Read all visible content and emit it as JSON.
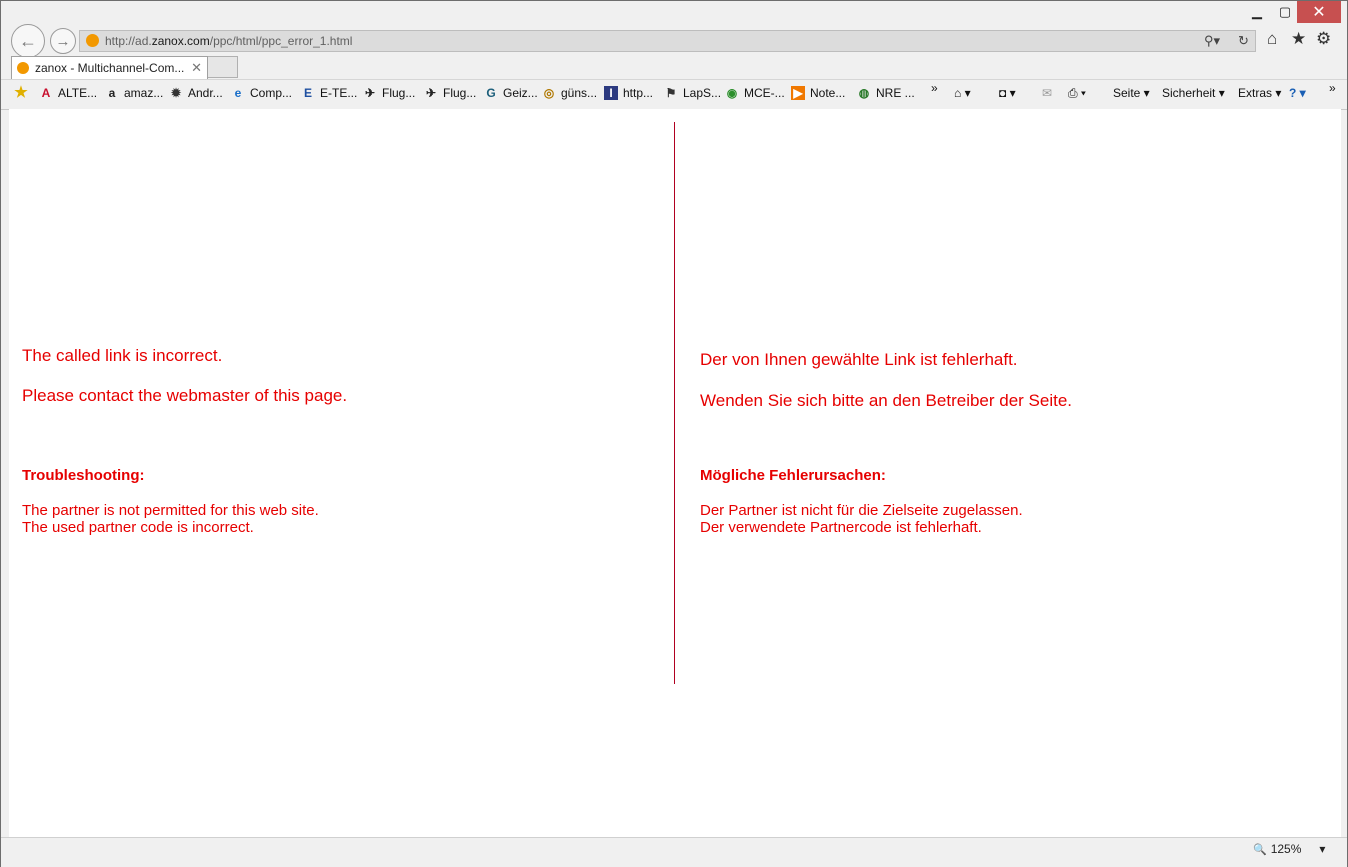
{
  "window": {
    "minimize": "▁",
    "maximize": "▢",
    "close": "✕"
  },
  "nav": {
    "back_icon": "←",
    "forward_icon": "→"
  },
  "address": {
    "url_prefix": "http://ad.",
    "url_domain": "zanox.com",
    "url_path": "/ppc/html/ppc_error_1.html",
    "search_icon": "⚲▾",
    "refresh_icon": "↻"
  },
  "toolbar_right": {
    "home_icon": "⌂",
    "favorites_icon": "★",
    "tools_icon": "⚙"
  },
  "tab": {
    "title": "zanox - Multichannel-Com...",
    "close": "✕"
  },
  "favorites": [
    {
      "label": "ALTE...",
      "icon": "A",
      "color": "#c8102e"
    },
    {
      "label": "amaz...",
      "icon": "a",
      "color": "#222222"
    },
    {
      "label": "Andr...",
      "icon": "✹",
      "color": "#333333"
    },
    {
      "label": "Comp...",
      "icon": "e",
      "color": "#1a6fc9"
    },
    {
      "label": "E-TE...",
      "icon": "E",
      "color": "#1e4fa0"
    },
    {
      "label": "Flug...",
      "icon": "✈",
      "color": "#222222"
    },
    {
      "label": "Flug...",
      "icon": "✈",
      "color": "#222222"
    },
    {
      "label": "Geiz...",
      "icon": "G",
      "color": "#1b5e7a"
    },
    {
      "label": "güns...",
      "icon": "◎",
      "color": "#b07800"
    },
    {
      "label": "http...",
      "icon": "I",
      "color": "#ffffff"
    },
    {
      "label": "LapS...",
      "icon": "⚑",
      "color": "#333333"
    },
    {
      "label": "MCE-...",
      "icon": "◉",
      "color": "#2c8f2c"
    },
    {
      "label": "Note...",
      "icon": "▶",
      "color": "#ffffff"
    },
    {
      "label": "NRE ...",
      "icon": "◍",
      "color": "#2a7a2a"
    }
  ],
  "favorites_more": "»",
  "commands": {
    "home": "⌂ ▾",
    "feeds": "◘ ▾",
    "mail": "✉",
    "print": "⎙ ▾",
    "page": "Seite ▾",
    "safety": "Sicherheit ▾",
    "extras": "Extras ▾",
    "help": "? ▾",
    "more": "»"
  },
  "page": {
    "en": {
      "line1": "The called link is incorrect.",
      "line2": "Please contact the webmaster of this page.",
      "heading": "Troubleshooting:",
      "cause1": "The partner is not permitted for this web site.",
      "cause2": "The used partner code is incorrect."
    },
    "de": {
      "line1": "Der von Ihnen gewählte Link ist fehlerhaft.",
      "line2": "Wenden Sie sich bitte an den Betreiber der Seite.",
      "heading": "Mögliche Fehlerursachen:",
      "cause1": "Der Partner ist nicht für die Zielseite zugelassen.",
      "cause2": "Der verwendete Partnercode ist fehlerhaft."
    }
  },
  "status": {
    "zoom_icon": "🔍",
    "zoom": "125%",
    "zoom_dropdown": "▾"
  }
}
